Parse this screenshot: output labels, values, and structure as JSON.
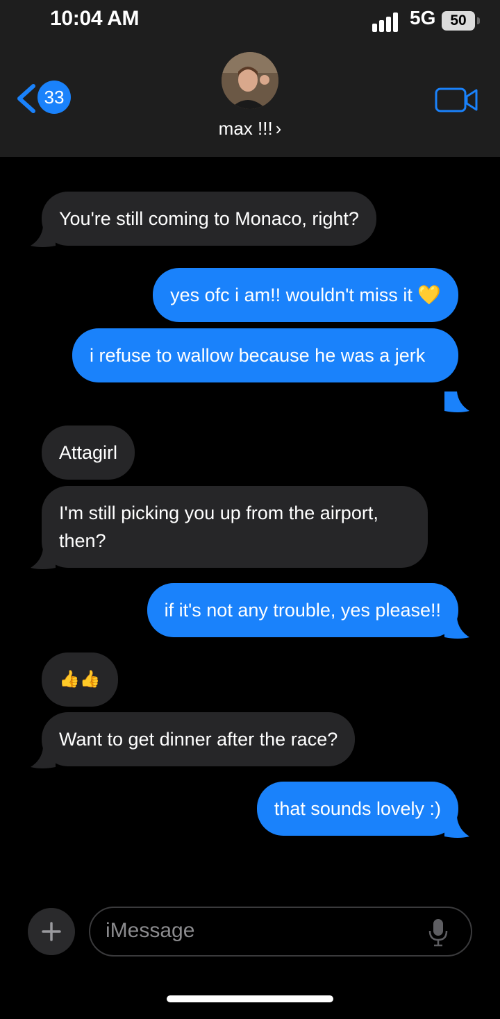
{
  "status_bar": {
    "time": "10:04 AM",
    "network": "5G",
    "battery": "50"
  },
  "nav": {
    "back_count": "33",
    "contact_name": "max !!!",
    "chevron": "›"
  },
  "messages": [
    {
      "side": "in",
      "text": "You're still coming to Monaco, right?"
    },
    {
      "side": "out",
      "text": "yes ofc i am!! wouldn't miss it 💛"
    },
    {
      "side": "out",
      "text": "i refuse to wallow because he was a jerk"
    },
    {
      "side": "in",
      "text": "Attagirl"
    },
    {
      "side": "in",
      "text": "I'm still picking you up from the airport, then?"
    },
    {
      "side": "out",
      "text": "if it's not any trouble, yes please!!"
    },
    {
      "side": "in",
      "text": "👍👍"
    },
    {
      "side": "in",
      "text": "Want to get dinner after the race?"
    },
    {
      "side": "out",
      "text": "that sounds lovely :)"
    }
  ],
  "composer": {
    "placeholder": "iMessage"
  },
  "colors": {
    "accent": "#1a82fb",
    "incoming": "#262628",
    "header": "#1e1e1e"
  },
  "icons": [
    "back-chevron-icon",
    "video-call-icon",
    "plus-icon",
    "microphone-icon",
    "signal-icon"
  ]
}
